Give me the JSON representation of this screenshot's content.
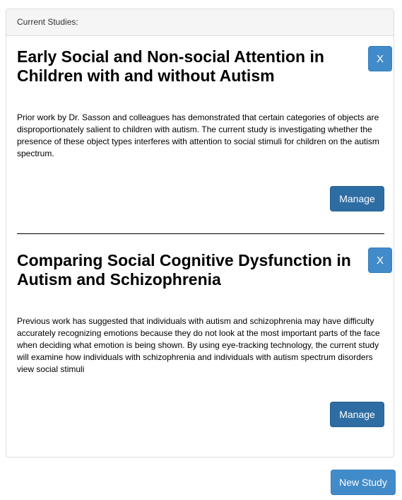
{
  "panel": {
    "heading": "Current Studies:"
  },
  "studies": [
    {
      "title": "Early Social and Non-social Attention in Children with and without Autism",
      "description": "Prior work by Dr. Sasson and colleagues has demonstrated that certain categories of objects are disproportionately salient to children with autism. The current study is investigating whether the presence of these object types interferes with attention to social stimuli for children on the autism spectrum.",
      "remove_label": "X",
      "manage_label": "Manage"
    },
    {
      "title": "Comparing Social Cognitive Dysfunction in Autism and Schizophrenia",
      "description": "Previous work has suggested that individuals with autism and schizophrenia may have difficulty accurately recognizing emotions because they do not look at the most important parts of the face when deciding what emotion is being shown. By using eye-tracking technology, the current study will examine how individuals with schizophrenia and individuals with autism spectrum disorders view social stimuli",
      "remove_label": "X",
      "manage_label": "Manage"
    }
  ],
  "actions": {
    "new_study_label": "New Study"
  },
  "colors": {
    "primary": "#428bca",
    "primary_dark": "#2e6da4",
    "panel_heading_bg": "#f5f5f5",
    "border": "#dddddd"
  }
}
